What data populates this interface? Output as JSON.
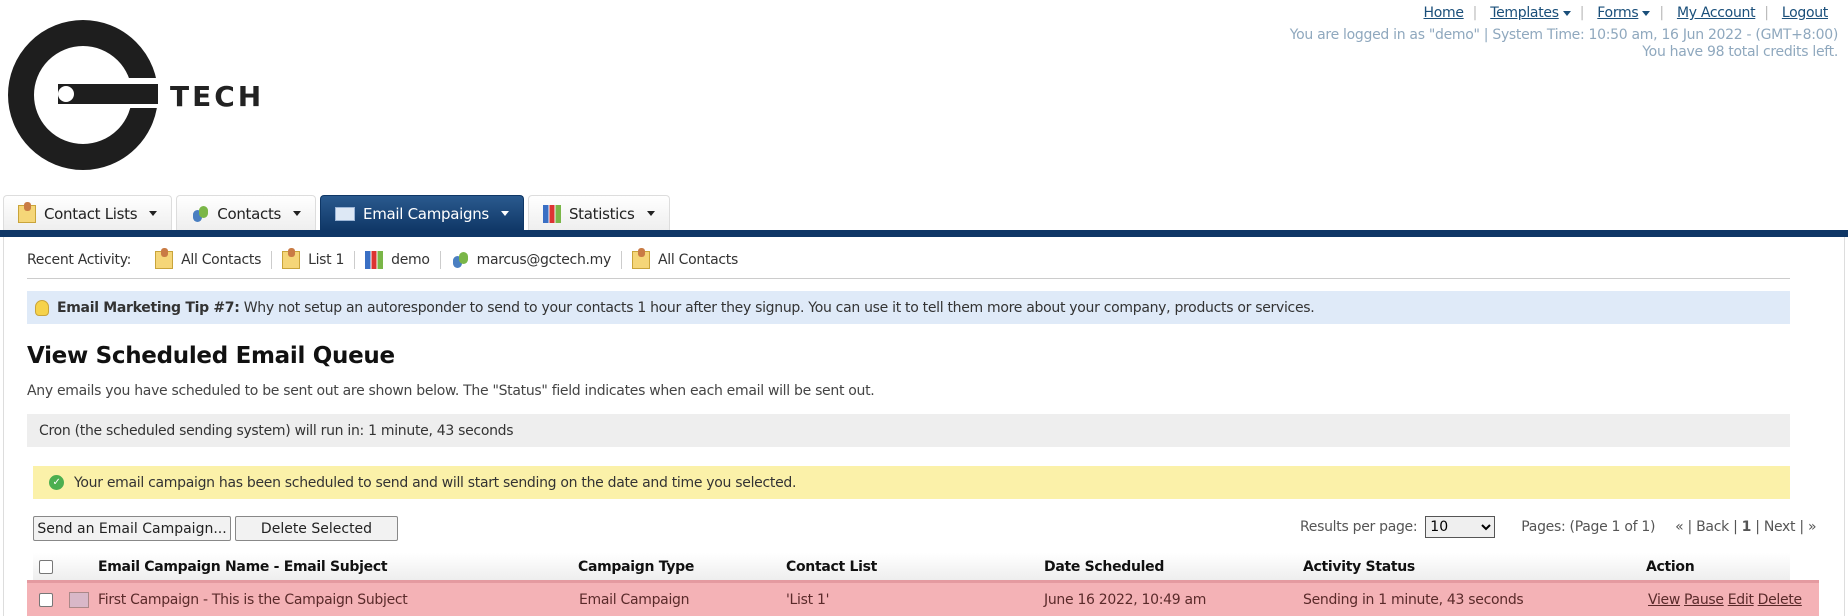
{
  "header": {
    "logo_text": "TECH",
    "links": [
      {
        "label": "Home"
      },
      {
        "label": "Templates",
        "dropdown": true
      },
      {
        "label": "Forms",
        "dropdown": true
      },
      {
        "label": "My Account"
      },
      {
        "label": "Logout"
      }
    ],
    "login_info": "You are logged in as \"demo\" | System Time: 10:50 am, 16 Jun 2022 - (GMT+8:00)",
    "credits": "You have 98 total credits left."
  },
  "tabs": [
    {
      "label": "Contact Lists",
      "icon": "contact-list-icon"
    },
    {
      "label": "Contacts",
      "icon": "contacts-icon"
    },
    {
      "label": "Email Campaigns",
      "icon": "envelope-icon",
      "active": true
    },
    {
      "label": "Statistics",
      "icon": "bar-chart-icon"
    }
  ],
  "recent": {
    "label": "Recent Activity:",
    "items": [
      {
        "label": "All Contacts",
        "icon": "contact-list-icon"
      },
      {
        "label": "List 1",
        "icon": "contact-list-icon"
      },
      {
        "label": "demo",
        "icon": "bar-chart-icon"
      },
      {
        "label": "marcus@gctech.my",
        "icon": "contacts-icon"
      },
      {
        "label": "All Contacts",
        "icon": "contact-list-icon"
      }
    ]
  },
  "tip": {
    "title": "Email Marketing Tip #7:",
    "text": " Why not setup an autoresponder to send to your contacts 1 hour after they signup. You can use it to tell them more about your company, products or services."
  },
  "page": {
    "title": "View Scheduled Email Queue",
    "description": "Any emails you have scheduled to be sent out are shown below. The \"Status\" field indicates when each email will be sent out.",
    "cron": "Cron (the scheduled sending system) will run in: 1 minute, 43 seconds",
    "success": "Your email campaign has been scheduled to send and will start sending on the date and time you selected."
  },
  "toolbar": {
    "send_label": "Send an Email Campaign...",
    "delete_label": "Delete Selected",
    "rpp_label": "Results per page:",
    "rpp_value": "10",
    "pages": "Pages: (Page 1 of 1)",
    "first": "«",
    "back": "Back",
    "current": "1",
    "next": "Next",
    "last": "»"
  },
  "table": {
    "columns": [
      "Email Campaign Name - Email Subject",
      "Campaign Type",
      "Contact List",
      "Date Scheduled",
      "Activity Status",
      "Action"
    ],
    "rows": [
      {
        "name": "First Campaign - This is the Campaign Subject",
        "type": "Email Campaign",
        "list": "'List 1'",
        "date": "June 16 2022, 10:49 am",
        "status": "Sending in 1 minute, 43 seconds",
        "actions": [
          "View",
          "Pause",
          "Edit",
          "Delete"
        ]
      }
    ]
  },
  "colors": {
    "nav_blue": "#0f3766",
    "row_highlight": "#f4b2b6",
    "tip_bg": "#dfeaf8",
    "success_bg": "#fbf1a9"
  }
}
